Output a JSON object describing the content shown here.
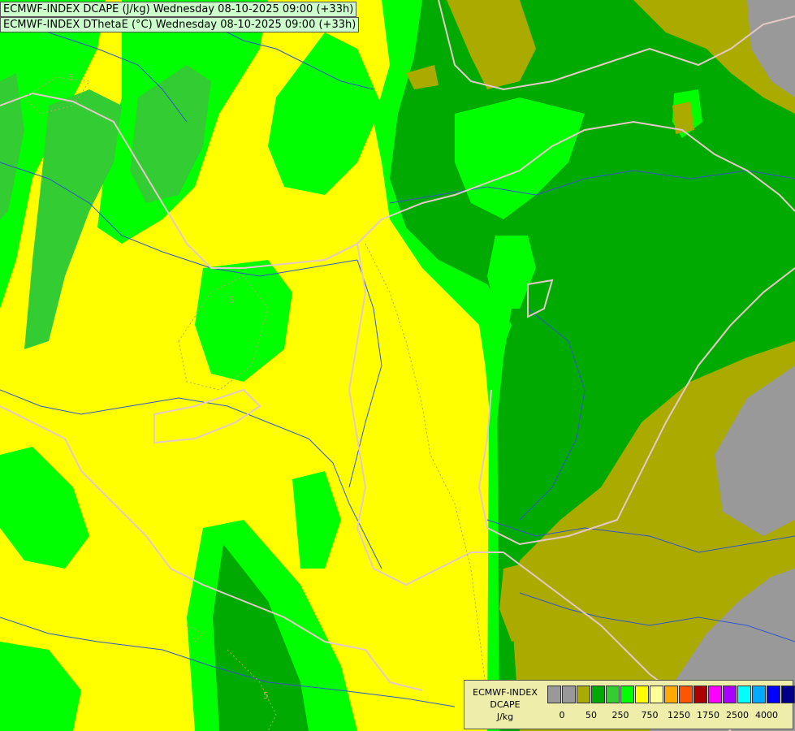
{
  "titles": {
    "line1": "ECMWF-INDEX DCAPE (J/kg) Wednesday 08-10-2025 09:00 (+33h)",
    "line2": "ECMWF-INDEX DThetaE (°C) Wednesday 08-10-2025 09:00 (+33h)"
  },
  "map": {
    "contour_label": "5",
    "colors": {
      "yellow": "#ffff00",
      "light_green": "#00ff00",
      "mid_green": "#33cc33",
      "dark_green": "#00aa00",
      "olive": "#aaaa00",
      "gray": "#999999",
      "border": "#e8c9c9",
      "river": "#3355cc"
    }
  },
  "legend": {
    "title_line1": "ECMWF-INDEX",
    "title_line2": "DCAPE",
    "unit": "J/kg",
    "swatch_colors": [
      "#999999",
      "#999999",
      "#aaaa00",
      "#00aa00",
      "#33cc33",
      "#00ff00",
      "#ffff00",
      "#ffff99",
      "#ffaa00",
      "#ff5500",
      "#aa0000",
      "#ff00ff",
      "#aa00ff",
      "#00ffff",
      "#00aaff",
      "#0000ff",
      "#000088"
    ],
    "tick_labels": [
      "0",
      "50",
      "250",
      "750",
      "1250",
      "1750",
      "2500",
      "4000"
    ]
  }
}
